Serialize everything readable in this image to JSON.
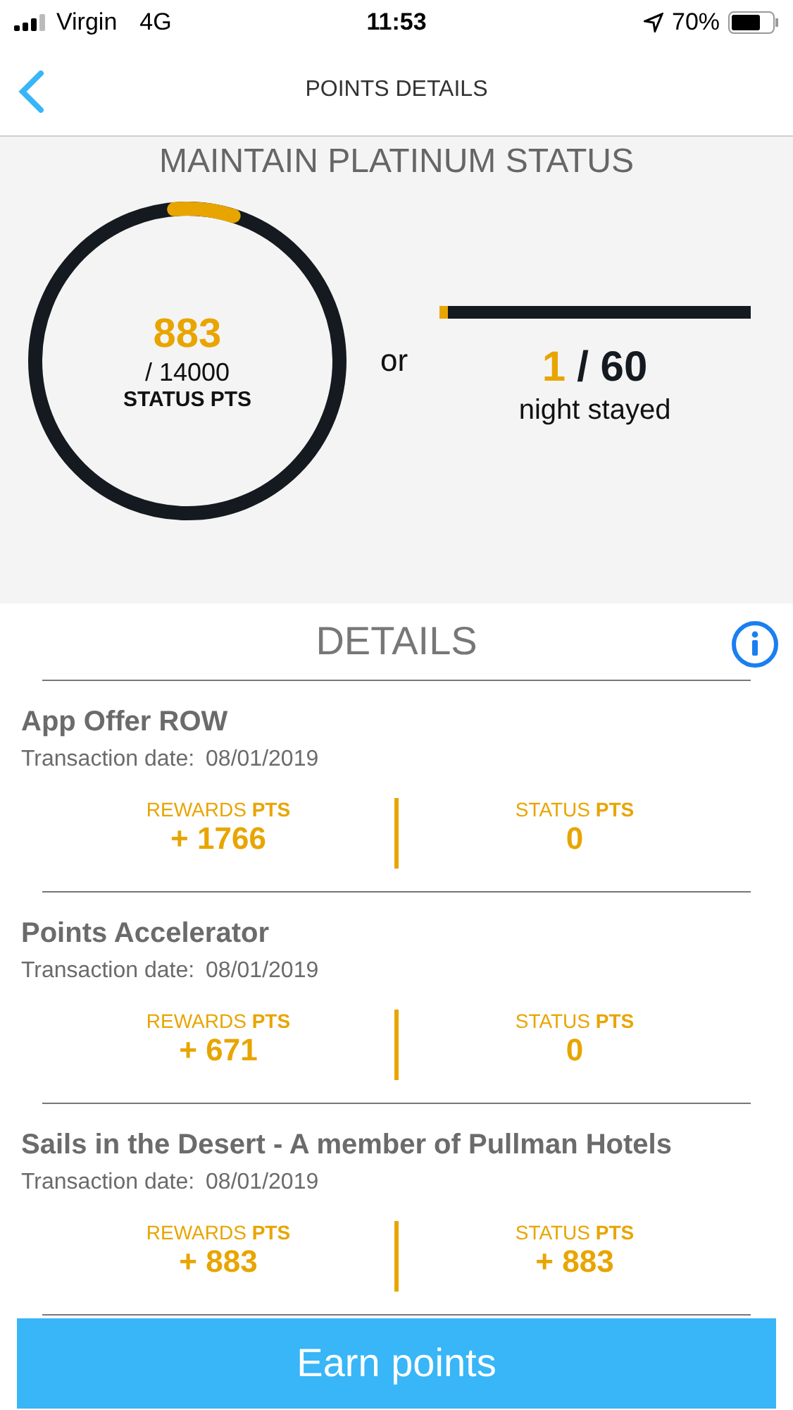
{
  "status_bar": {
    "carrier": "Virgin",
    "network": "4G",
    "time": "11:53",
    "battery": "70%"
  },
  "nav": {
    "title": "POINTS DETAILS"
  },
  "summary": {
    "title": "MAINTAIN PLATINUM STATUS",
    "ring": {
      "level": 0.063,
      "value": "883",
      "total": "/ 14000",
      "unit": "STATUS PTS"
    },
    "separator": "or",
    "nights": {
      "level": 0.017,
      "value": "1",
      "total": "/ 60",
      "unit": "night stayed"
    }
  },
  "details": {
    "title": "DETAILS",
    "items": [
      {
        "name": "App Offer ROW",
        "date_label": "Transaction date:",
        "date": "08/01/2019",
        "rewards_label": "REWARDS **PTS**",
        "rewards": "+ 1766",
        "status_label": "STATUS **PTS**",
        "status": "0"
      },
      {
        "name": "Points Accelerator",
        "date_label": "Transaction date:",
        "date": "08/01/2019",
        "rewards_label": "REWARDS **PTS**",
        "rewards": "+ 671",
        "status_label": "STATUS **PTS**",
        "status": "0"
      },
      {
        "name": "Sails in the Desert - A member of Pullman Hotels",
        "date_label": "Transaction date:",
        "date": "08/01/2019",
        "rewards_label": "REWARDS **PTS**",
        "rewards": "+ 883",
        "status_label": "STATUS **PTS**",
        "status": "+ 883"
      }
    ]
  },
  "action": {
    "label": "Earn points"
  }
}
